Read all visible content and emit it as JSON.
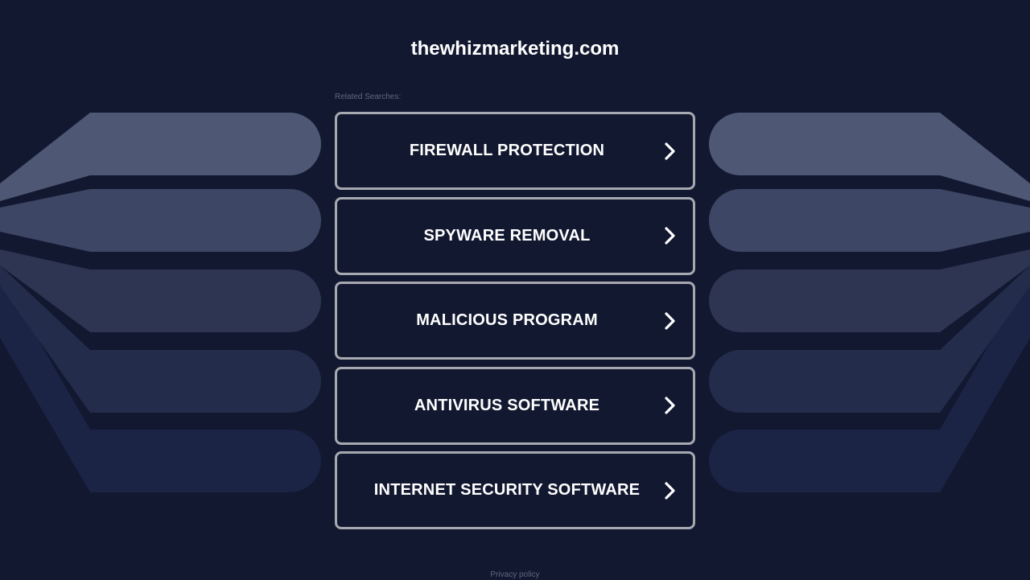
{
  "site_title": "thewhizmarketing.com",
  "related_label": "Related Searches:",
  "searches": [
    {
      "label": "FIREWALL PROTECTION"
    },
    {
      "label": "SPYWARE REMOVAL"
    },
    {
      "label": "MALICIOUS PROGRAM"
    },
    {
      "label": "ANTIVIRUS SOFTWARE"
    },
    {
      "label": "INTERNET SECURITY SOFTWARE"
    }
  ],
  "footer": {
    "privacy_label": "Privacy policy"
  },
  "colors": {
    "background": "#121830",
    "button_border": "#a7a9b1",
    "text": "#ffffff",
    "muted_text": "#5f6780",
    "wing_shades": [
      "#4e5774",
      "#3d4664",
      "#2d3553",
      "#242c4c",
      "#1c2446"
    ]
  },
  "icons": {
    "button_arrow": "chevron-right-icon"
  }
}
